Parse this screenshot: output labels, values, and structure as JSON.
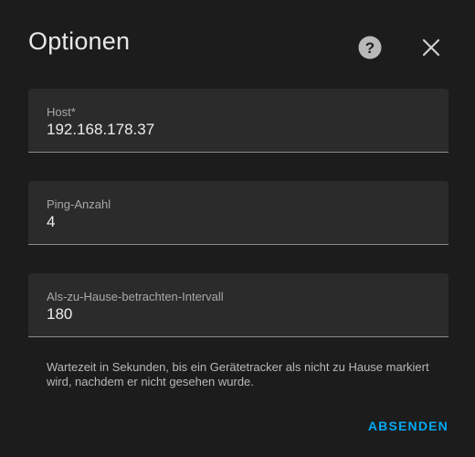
{
  "dialog": {
    "title": "Optionen",
    "help_icon": "help-circle-icon",
    "close_icon": "close-icon"
  },
  "fields": [
    {
      "label": "Host*",
      "value": "192.168.178.37"
    },
    {
      "label": "Ping-Anzahl",
      "value": "4"
    },
    {
      "label": "Als-zu-Hause-betrachten-Intervall",
      "value": "180"
    }
  ],
  "helper_text": "Wartezeit in Sekunden, bis ein Gerätetracker als nicht zu Hause markiert wird, nachdem er nicht gesehen wurde.",
  "actions": {
    "submit_label": "ABSENDEN"
  },
  "colors": {
    "background": "#1c1c1c",
    "field_background": "#2b2b2b",
    "accent": "#03a9f4"
  }
}
